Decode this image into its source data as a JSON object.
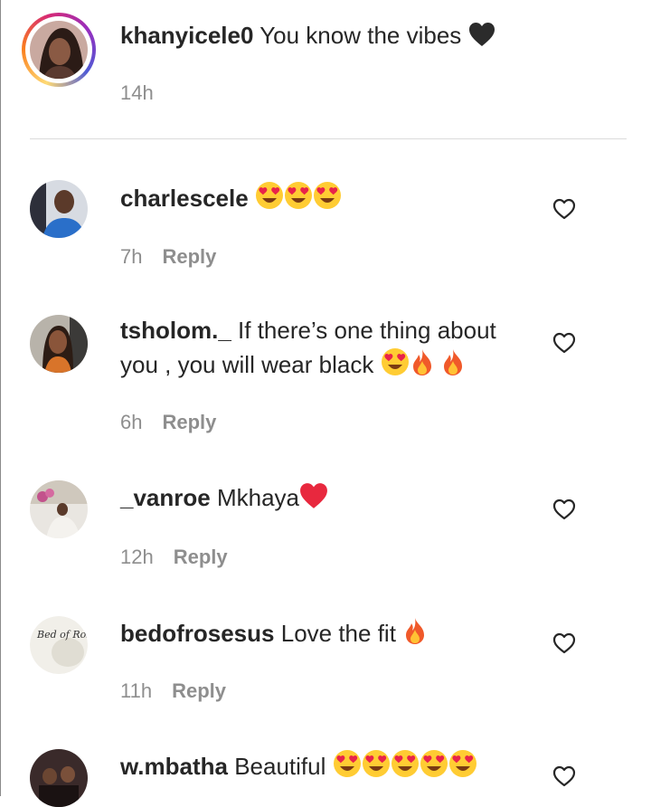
{
  "caption": {
    "username": "khanyicele0",
    "text": "You know the vibes",
    "emoji": "black-heart",
    "time": "14h"
  },
  "comments": [
    {
      "username": "charlescele",
      "line1": "",
      "line2": "",
      "emojis": [
        "heart-eyes",
        "heart-eyes",
        "heart-eyes"
      ],
      "time": "7h",
      "reply": "Reply"
    },
    {
      "username": "tsholom._",
      "line1": "If there’s one thing about",
      "line2": "you , you will wear black",
      "emojis": [
        "heart-eyes",
        "fire",
        "fire"
      ],
      "time": "6h",
      "reply": "Reply"
    },
    {
      "username": "_vanroe",
      "line1": "Mkhaya",
      "line2": "",
      "emojis": [
        "red-heart"
      ],
      "time": "12h",
      "reply": "Reply"
    },
    {
      "username": "bedofrosesus",
      "line1": "Love the fit",
      "line2": "",
      "emojis": [
        "fire"
      ],
      "time": "11h",
      "reply": "Reply"
    },
    {
      "username": "w.mbatha",
      "line1": "Beautiful",
      "line2": "",
      "emojis": [
        "heart-eyes",
        "heart-eyes",
        "heart-eyes",
        "heart-eyes",
        "heart-eyes"
      ],
      "time": "",
      "reply": ""
    }
  ],
  "avatars": {
    "bedofrosesus_logo": "Bed of Roses"
  },
  "colors": {
    "username": "#262626",
    "meta": "#8e8e8e",
    "divider": "#dbdbdb"
  },
  "icons": [
    "like-heart-outline-icon"
  ]
}
